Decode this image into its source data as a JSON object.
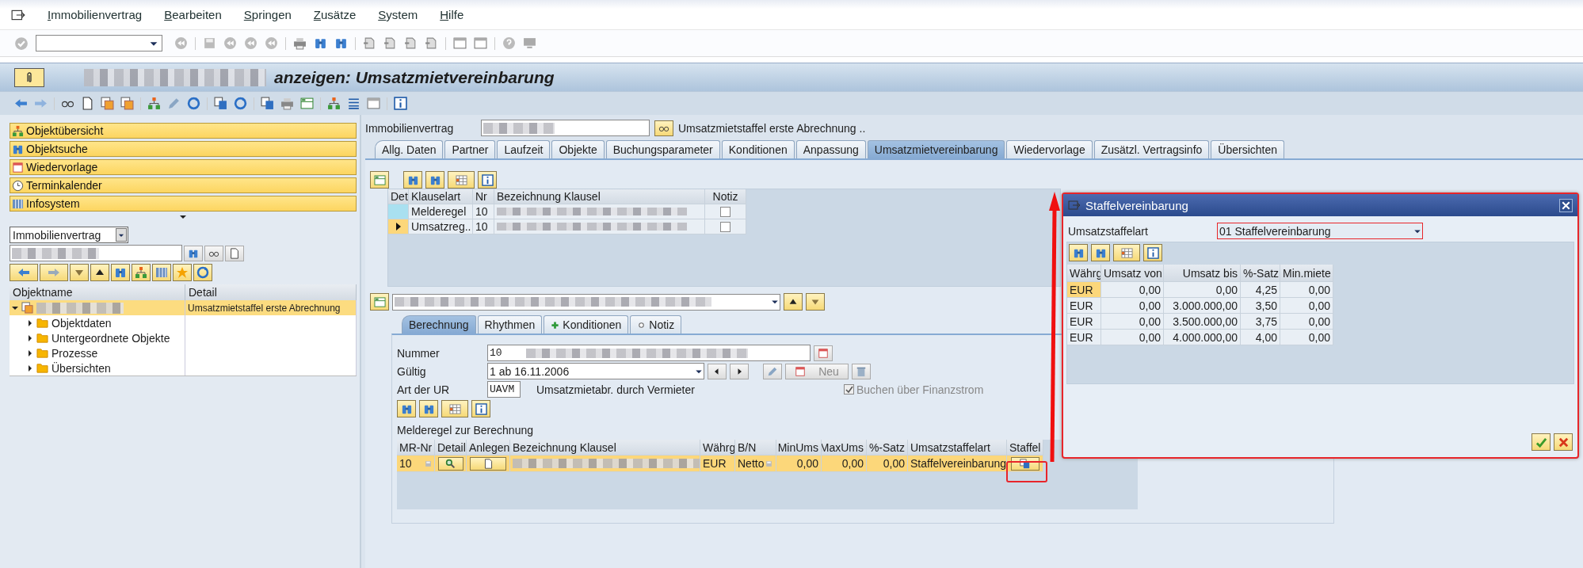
{
  "menu": [
    "Immobilienvertrag",
    "Bearbeiten",
    "Springen",
    "Zusätze",
    "System",
    "Hilfe"
  ],
  "title": "anzeigen: Umsatzmietvereinbarung",
  "nav_buttons": [
    {
      "label": "Objektübersicht"
    },
    {
      "label": "Objektsuche"
    },
    {
      "label": "Wiedervorlage"
    },
    {
      "label": "Terminkalender"
    },
    {
      "label": "Infosystem"
    }
  ],
  "object_type_select": {
    "value": "Immobilienvertrag"
  },
  "tree": {
    "columns": [
      "Objektname",
      "Detail"
    ],
    "nodes": [
      {
        "detail": "Umsatzmietstaffel erste Abrechnung",
        "selected": true,
        "expanded": true,
        "children": [
          {
            "label": "Objektdaten",
            "expanded": false,
            "selected": false
          },
          {
            "label": "Untergeordnete Objekte",
            "expanded": false,
            "selected": false
          },
          {
            "label": "Prozesse",
            "expanded": false,
            "selected": false
          },
          {
            "label": "Übersichten",
            "expanded": false,
            "selected": false
          }
        ]
      }
    ]
  },
  "contract_header": {
    "label": "Immobilienvertrag",
    "description": "Umsatzmietstaffel erste Abrechnung .."
  },
  "tabs": [
    {
      "label": "Allg. Daten",
      "selected": false
    },
    {
      "label": "Partner",
      "selected": false
    },
    {
      "label": "Laufzeit",
      "selected": false
    },
    {
      "label": "Objekte",
      "selected": false
    },
    {
      "label": "Buchungsparameter",
      "selected": false
    },
    {
      "label": "Konditionen",
      "selected": false
    },
    {
      "label": "Anpassung",
      "selected": false
    },
    {
      "label": "Umsatzmietvereinbarung",
      "selected": true
    },
    {
      "label": "Wiedervorlage",
      "selected": false
    },
    {
      "label": "Zusätzl. Vertragsinfo",
      "selected": false
    },
    {
      "label": "Übersichten",
      "selected": false
    }
  ],
  "clauses": {
    "columns": [
      "Det",
      "Klauselart",
      "Nr",
      "Bezeichnung Klausel",
      "Notiz"
    ],
    "rows": [
      {
        "type": "Melderegel",
        "nr": "10",
        "note_checked": false,
        "selected": false
      },
      {
        "type": "Umsatzreg..",
        "nr": "10",
        "note_checked": false,
        "selected": true
      }
    ]
  },
  "sub_tabs": [
    {
      "label": "Berechnung",
      "selected": true
    },
    {
      "label": "Rhythmen",
      "selected": false
    },
    {
      "label": "Konditionen",
      "selected": false
    },
    {
      "label": "Notiz",
      "selected": false
    }
  ],
  "calc": {
    "number_label": "Nummer",
    "number": "10",
    "valid_label": "Gültig",
    "valid": "1 ab 16.11.2006",
    "new_button": {
      "label": "Neu",
      "disabled": true
    },
    "type_label": "Art der UR",
    "type_code": "UAVM",
    "type_text": "Umsatzmietabr. durch Vermieter",
    "posting_checkbox": {
      "label": "Buchen über Finanzstrom",
      "checked": true,
      "disabled": true
    }
  },
  "report_rules": {
    "title": "Melderegel zur Berechnung",
    "columns": [
      "MR-Nr",
      "Detail",
      "Anlegen",
      "Bezeichnung Klausel",
      "Währg",
      "B/N",
      "MinUms",
      "MaxUms",
      "%-Satz",
      "Umsatzstaffelart",
      "Staffel"
    ],
    "rows": [
      {
        "mr_nr": "10",
        "currency": "EUR",
        "bn": "Netto",
        "min": "0,00",
        "max": "0,00",
        "rate": "0,00",
        "staffel_type": "Staffelvereinbarung",
        "selected": true
      }
    ]
  },
  "dialog": {
    "title": "Staffelvereinbarung",
    "field_label": "Umsatzstaffelart",
    "field_value": "01 Staffelvereinbarung",
    "columns": [
      "Währg",
      "Umsatz von",
      "Umsatz bis",
      "%-Satz",
      "Min.miete"
    ],
    "rows": [
      {
        "currency": "EUR",
        "from": "0,00",
        "to": "0,00",
        "rate": "4,25",
        "min_rent": "0,00",
        "selected": true
      },
      {
        "currency": "EUR",
        "from": "0,00",
        "to": "3.000.000,00",
        "rate": "3,50",
        "min_rent": "0,00",
        "selected": false
      },
      {
        "currency": "EUR",
        "from": "0,00",
        "to": "3.500.000,00",
        "rate": "3,75",
        "min_rent": "0,00",
        "selected": false
      },
      {
        "currency": "EUR",
        "from": "0,00",
        "to": "4.000.000,00",
        "rate": "4,00",
        "min_rent": "0,00",
        "selected": false
      }
    ]
  }
}
